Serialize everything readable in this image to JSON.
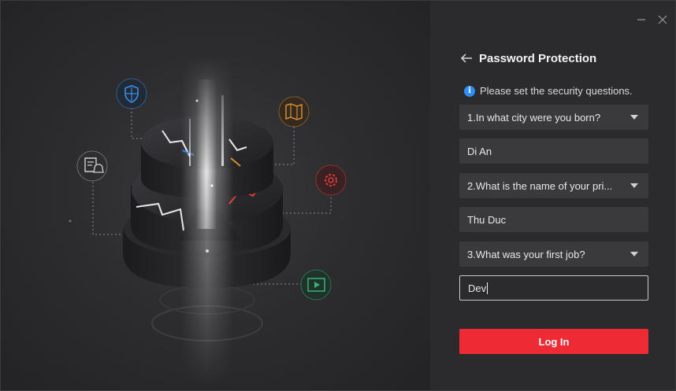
{
  "window": {
    "minimize_icon": "minimize-icon",
    "close_icon": "close-icon"
  },
  "illustration": {
    "icons": [
      "shield-icon",
      "map-icon",
      "document-bell-icon",
      "gear-icon",
      "video-icon"
    ],
    "colors": {
      "shield": "#3a8fe8",
      "map": "#d88a2c",
      "gear": "#e03a3a",
      "video": "#38b27a",
      "document": "#cfcfcf"
    }
  },
  "form": {
    "title": "Password Protection",
    "hint": "Please set the security questions.",
    "questions": [
      {
        "question": "1.In what city were you born?",
        "answer": "Di An"
      },
      {
        "question": "2.What is the name of your pri...",
        "answer": "Thu Duc"
      },
      {
        "question": "3.What was your first job?",
        "answer": "Dev"
      }
    ],
    "submit_label": "Log In"
  },
  "colors": {
    "accent": "#ee2a35",
    "info": "#2f8ef5"
  }
}
